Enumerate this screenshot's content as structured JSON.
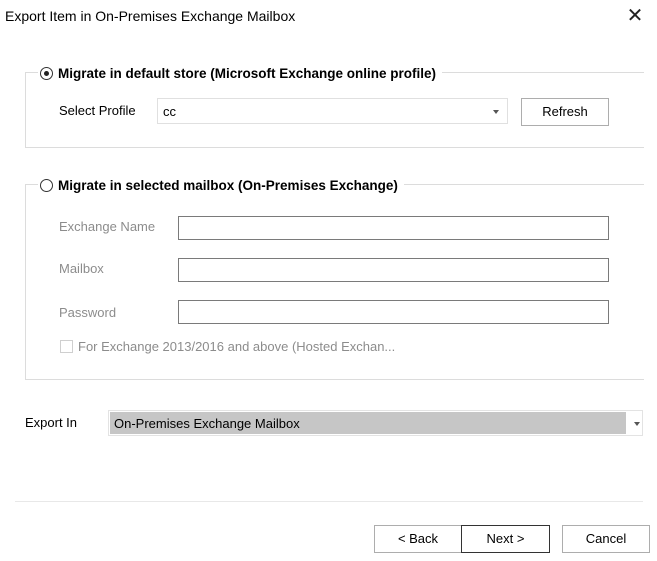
{
  "window": {
    "title": "Export Item in On-Premises Exchange Mailbox"
  },
  "default_store": {
    "label": "Migrate in default store (Microsoft Exchange online profile)",
    "selected": true,
    "profile_label": "Select Profile",
    "profile_value": "cc",
    "refresh_label": "Refresh"
  },
  "selected_mailbox": {
    "label": "Migrate in selected mailbox (On-Premises Exchange)",
    "selected": false,
    "exchange_name_label": "Exchange Name",
    "mailbox_label": "Mailbox",
    "password_label": "Password",
    "hosted_checkbox_label": "For Exchange 2013/2016 and above (Hosted Exchan..."
  },
  "export_in": {
    "label": "Export In",
    "value": "On-Premises Exchange Mailbox"
  },
  "footer": {
    "back_label": "< Back",
    "next_label": "Next >",
    "cancel_label": "Cancel"
  }
}
